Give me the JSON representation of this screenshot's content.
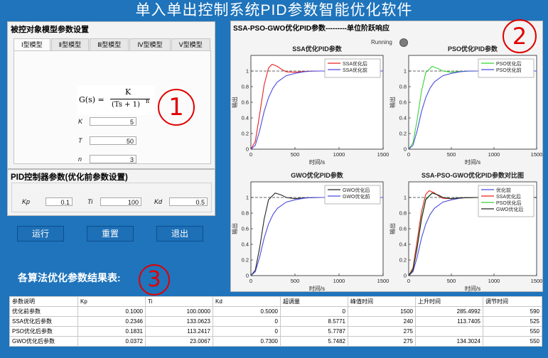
{
  "app_title": "单入单出控制系统PID参数智能优化软件",
  "model_panel": {
    "title": "被控对象模型参数设置",
    "tabs": [
      "Ⅰ型模型",
      "Ⅱ型模型",
      "Ⅲ型模型",
      "Ⅳ型模型",
      "Ⅴ型模型"
    ],
    "formula": {
      "lhs": "G(s) =",
      "numerator": "K",
      "denominator": "(Ts + 1)",
      "exponent": "n"
    },
    "params": [
      {
        "label": "K",
        "value": "5"
      },
      {
        "label": "T",
        "value": "50"
      },
      {
        "label": "n",
        "value": "3"
      }
    ]
  },
  "pid_panel": {
    "title": "PID控制器参数(优化前参数设置)",
    "params": [
      {
        "label": "Kp",
        "value": "0.1"
      },
      {
        "label": "Ti",
        "value": "100"
      },
      {
        "label": "Kd",
        "value": "0.5"
      }
    ]
  },
  "buttons": {
    "run": "运行",
    "reset": "重置",
    "exit": "退出"
  },
  "annotations": {
    "one": "1",
    "two": "2",
    "three": "3"
  },
  "response_panel": {
    "title": "SSA-PSO-GWO优化PID参数---------单位阶跃响应",
    "running_label": "Running"
  },
  "results": {
    "title": "各算法优化参数结果表:",
    "columns": [
      "参数说明",
      "Kp",
      "Ti",
      "Kd",
      "超调量",
      "峰值时间",
      "上升时间",
      "调节时间"
    ],
    "rows": [
      [
        "优化前参数",
        "0.1000",
        "100.0000",
        "0.5000",
        "0",
        "1500",
        "285.4992",
        "590"
      ],
      [
        "SSA优化后参数",
        "0.2346",
        "133.0623",
        "0",
        "8.5771",
        "240",
        "113.7405",
        "525"
      ],
      [
        "PSO优化后参数",
        "0.1831",
        "113.2417",
        "0",
        "5.7787",
        "275",
        "",
        "550"
      ],
      [
        "GWO优化后参数",
        "0.0372",
        "23.0067",
        "0.7300",
        "5.7482",
        "275",
        "134.3024",
        "550"
      ]
    ]
  },
  "colors": {
    "background": "#1f74bb",
    "ssa": "#e8211f",
    "pso": "#35d435",
    "gwo": "#222222",
    "before": "#4a4ae0",
    "reference": "#333333"
  },
  "chart_data": [
    {
      "type": "line",
      "title": "SSA优化PID参数",
      "xlabel": "时间/s",
      "ylabel": "输出",
      "xlim": [
        0,
        1500
      ],
      "ylim": [
        0,
        1.2
      ],
      "xticks": [
        0,
        500,
        1000,
        1500
      ],
      "yticks": [
        0,
        0.2,
        0.4,
        0.6,
        0.8,
        1
      ],
      "legend_position": "top-right",
      "series": [
        {
          "name": "SSA优化后",
          "color": "#e8211f",
          "x": [
            0,
            50,
            100,
            150,
            200,
            240,
            300,
            350,
            400,
            500,
            600,
            800,
            1000,
            1200,
            1500
          ],
          "y": [
            0,
            0.1,
            0.45,
            0.82,
            1.04,
            1.086,
            1.06,
            1.02,
            0.99,
            0.985,
            0.995,
            1.0,
            1.0,
            1.0,
            1.0
          ]
        },
        {
          "name": "SSA优化前",
          "color": "#4a4ae0",
          "x": [
            0,
            50,
            100,
            150,
            200,
            250,
            300,
            400,
            500,
            600,
            700,
            800,
            1000,
            1200,
            1500
          ],
          "y": [
            0,
            0.05,
            0.24,
            0.48,
            0.66,
            0.78,
            0.86,
            0.94,
            0.97,
            0.99,
            1.0,
            1.0,
            1.0,
            1.0,
            1.0
          ]
        }
      ]
    },
    {
      "type": "line",
      "title": "PSO优化PID参数",
      "xlabel": "时间/s",
      "ylabel": "输出",
      "xlim": [
        0,
        1500
      ],
      "ylim": [
        0,
        1.2
      ],
      "xticks": [
        0,
        500,
        1000,
        1500
      ],
      "yticks": [
        0,
        0.2,
        0.4,
        0.6,
        0.8,
        1
      ],
      "legend_position": "top-right",
      "series": [
        {
          "name": "PSO优化后",
          "color": "#35d435",
          "x": [
            0,
            50,
            100,
            150,
            200,
            275,
            350,
            400,
            500,
            600,
            800,
            1000,
            1200,
            1500
          ],
          "y": [
            0,
            0.08,
            0.38,
            0.74,
            0.98,
            1.058,
            1.03,
            1.0,
            0.985,
            0.995,
            1.0,
            1.0,
            1.0,
            1.0
          ]
        },
        {
          "name": "PSO优化前",
          "color": "#4a4ae0",
          "x": [
            0,
            50,
            100,
            150,
            200,
            250,
            300,
            400,
            500,
            600,
            700,
            800,
            1000,
            1200,
            1500
          ],
          "y": [
            0,
            0.05,
            0.24,
            0.48,
            0.66,
            0.78,
            0.86,
            0.94,
            0.97,
            0.99,
            1.0,
            1.0,
            1.0,
            1.0,
            1.0
          ]
        }
      ]
    },
    {
      "type": "line",
      "title": "GWO优化PID参数",
      "xlabel": "时间/s",
      "ylabel": "输出",
      "xlim": [
        0,
        1500
      ],
      "ylim": [
        0,
        1.2
      ],
      "xticks": [
        0,
        500,
        1000,
        1500
      ],
      "yticks": [
        0,
        0.2,
        0.4,
        0.6,
        0.8,
        1
      ],
      "legend_position": "top-right",
      "series": [
        {
          "name": "GWO优化后",
          "color": "#222222",
          "x": [
            0,
            50,
            100,
            150,
            200,
            275,
            350,
            400,
            500,
            600,
            800,
            1000,
            1200,
            1500
          ],
          "y": [
            0,
            0.07,
            0.36,
            0.72,
            0.97,
            1.057,
            1.03,
            1.0,
            0.985,
            0.995,
            1.0,
            1.0,
            1.0,
            1.0
          ]
        },
        {
          "name": "GWO优化前",
          "color": "#4a4ae0",
          "x": [
            0,
            50,
            100,
            150,
            200,
            250,
            300,
            400,
            500,
            600,
            700,
            800,
            1000,
            1200,
            1500
          ],
          "y": [
            0,
            0.05,
            0.24,
            0.48,
            0.66,
            0.78,
            0.86,
            0.94,
            0.97,
            0.99,
            1.0,
            1.0,
            1.0,
            1.0,
            1.0
          ]
        }
      ]
    },
    {
      "type": "line",
      "title": "SSA-PSO-GWO优化PID参数对比图",
      "xlabel": "时间/s",
      "ylabel": "输出",
      "xlim": [
        0,
        1500
      ],
      "ylim": [
        0,
        1.2
      ],
      "xticks": [
        0,
        500,
        1000,
        1500
      ],
      "yticks": [
        0,
        0.2,
        0.4,
        0.6,
        0.8,
        1
      ],
      "legend_position": "top-right",
      "series": [
        {
          "name": "优化前",
          "color": "#4a4ae0",
          "x": [
            0,
            50,
            100,
            150,
            200,
            250,
            300,
            400,
            500,
            600,
            700,
            800,
            1000,
            1200,
            1500
          ],
          "y": [
            0,
            0.05,
            0.24,
            0.48,
            0.66,
            0.78,
            0.86,
            0.94,
            0.97,
            0.99,
            1.0,
            1.0,
            1.0,
            1.0,
            1.0
          ]
        },
        {
          "name": "SSA优化后",
          "color": "#e8211f",
          "x": [
            0,
            50,
            100,
            150,
            200,
            240,
            300,
            350,
            400,
            500,
            600,
            800,
            1000,
            1200,
            1500
          ],
          "y": [
            0,
            0.1,
            0.45,
            0.82,
            1.04,
            1.086,
            1.06,
            1.02,
            0.99,
            0.985,
            0.995,
            1.0,
            1.0,
            1.0,
            1.0
          ]
        },
        {
          "name": "PSO优化后",
          "color": "#35d435",
          "x": [
            0,
            50,
            100,
            150,
            200,
            275,
            350,
            400,
            500,
            600,
            800,
            1000,
            1200,
            1500
          ],
          "y": [
            0,
            0.08,
            0.38,
            0.74,
            0.98,
            1.058,
            1.03,
            1.0,
            0.985,
            0.995,
            1.0,
            1.0,
            1.0,
            1.0
          ]
        },
        {
          "name": "GWO优化后",
          "color": "#222222",
          "x": [
            0,
            50,
            100,
            150,
            200,
            275,
            350,
            400,
            500,
            600,
            800,
            1000,
            1200,
            1500
          ],
          "y": [
            0,
            0.07,
            0.36,
            0.72,
            0.97,
            1.057,
            1.03,
            1.0,
            0.985,
            0.995,
            1.0,
            1.0,
            1.0,
            1.0
          ]
        }
      ]
    }
  ]
}
